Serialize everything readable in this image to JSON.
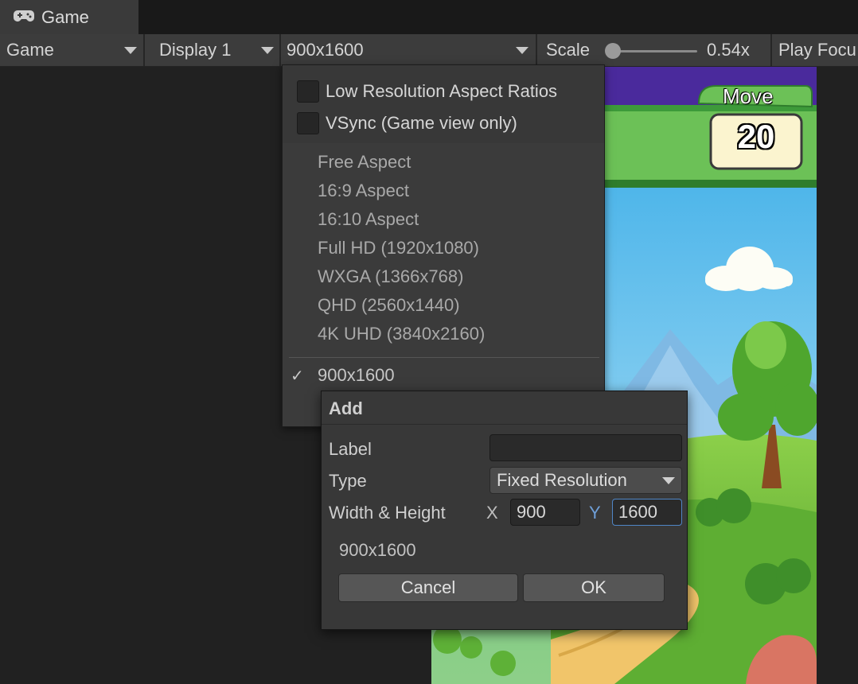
{
  "tab": {
    "title": "Game",
    "icon": "gamepad-icon"
  },
  "toolbar": {
    "view_mode": "Game",
    "display": "Display 1",
    "resolution": "900x1600",
    "scale_label": "Scale",
    "scale_value": "0.54x",
    "scale_level": 0.1,
    "play_focus": "Play Focu"
  },
  "menu": {
    "options": [
      {
        "label": "Low Resolution Aspect Ratios",
        "checked": false
      },
      {
        "label": "VSync (Game view only)",
        "checked": false
      }
    ],
    "items": [
      "Free Aspect",
      "16:9 Aspect",
      "16:10 Aspect",
      "Full HD (1920x1080)",
      "WXGA (1366x768)",
      "QHD (2560x1440)",
      "4K UHD (3840x2160)"
    ],
    "selected_item": "900x1600",
    "check_mark": "✓"
  },
  "dialog": {
    "title": "Add",
    "label_label": "Label",
    "label_value": "",
    "type_label": "Type",
    "type_value": "Fixed Resolution",
    "size_label": "Width & Height",
    "x_label": "X",
    "x_value": "900",
    "y_label": "Y",
    "y_value": "1600",
    "preview": "900x1600",
    "cancel": "Cancel",
    "ok": "OK"
  },
  "game": {
    "move_label": "Move",
    "move_value": "20"
  },
  "colors": {
    "accent_blue": "#4f86c6",
    "y_axis_color": "#6f9fd8"
  }
}
